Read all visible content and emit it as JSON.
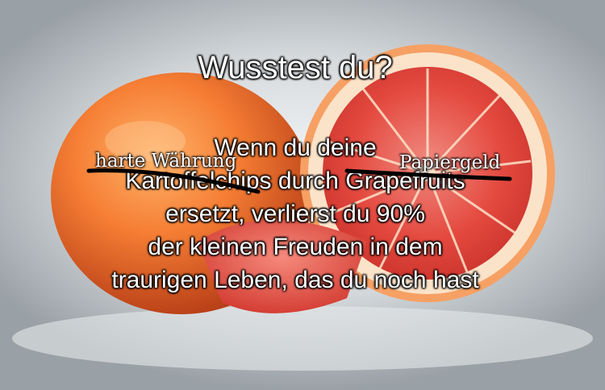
{
  "meme": {
    "title": "Wusstest du?",
    "lines": [
      "Wenn du deine",
      "Kartoffelchips durch Grapefruits",
      "ersetzt, verlierst du 90%",
      "der kleinen Freuden in dem",
      "traurigen Leben, das du noch hast"
    ],
    "overlay_left": "harte Währung",
    "overlay_right": "Papiergeld"
  },
  "colors": {
    "text": "#ffffff",
    "grapefruit_peel": "#f2793a",
    "grapefruit_flesh": "#e8453c",
    "pith": "#fbe3c9"
  }
}
